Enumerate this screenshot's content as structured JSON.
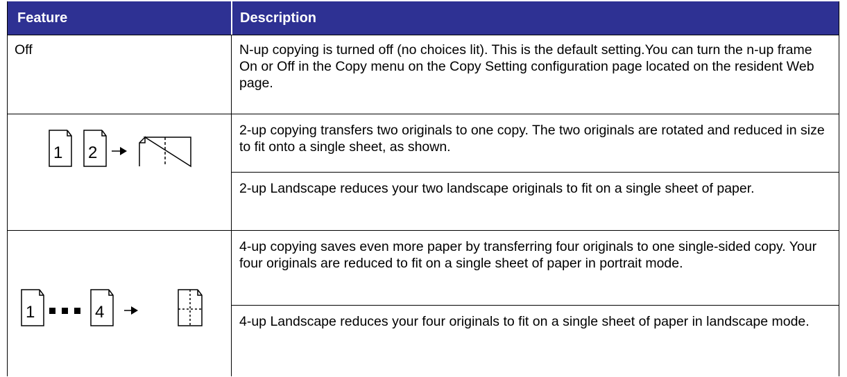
{
  "header": {
    "feature": "Feature",
    "description": "Description"
  },
  "rows": [
    {
      "feature": "Off",
      "description": "N-up copying is turned off (no choices lit). This is the default setting.You can turn the n-up frame On or Off in the Copy menu on the Copy Setting configuration page located on the resident Web page."
    },
    {
      "description": "2-up copying transfers two originals to one copy. The two originals are rotated and reduced in size to fit onto a single sheet, as shown."
    },
    {
      "description": "2-up Landscape reduces your two landscape originals to fit on a single sheet of paper."
    },
    {
      "description": "4-up copying saves even more paper by transferring four originals to one single-sided copy. Your four originals are reduced to fit on a single sheet of paper in portrait mode."
    },
    {
      "description": "4-up Landscape reduces your four originals to fit on a single sheet of paper in landscape mode."
    }
  ],
  "icons": {
    "two_up": {
      "page1": "1",
      "page2": "2",
      "icon": "2-up-icon"
    },
    "four_up": {
      "page1": "1",
      "page4": "4",
      "icon": "4-up-icon"
    }
  },
  "colors": {
    "header_bg": "#2e3193",
    "header_text": "#ffffff"
  }
}
